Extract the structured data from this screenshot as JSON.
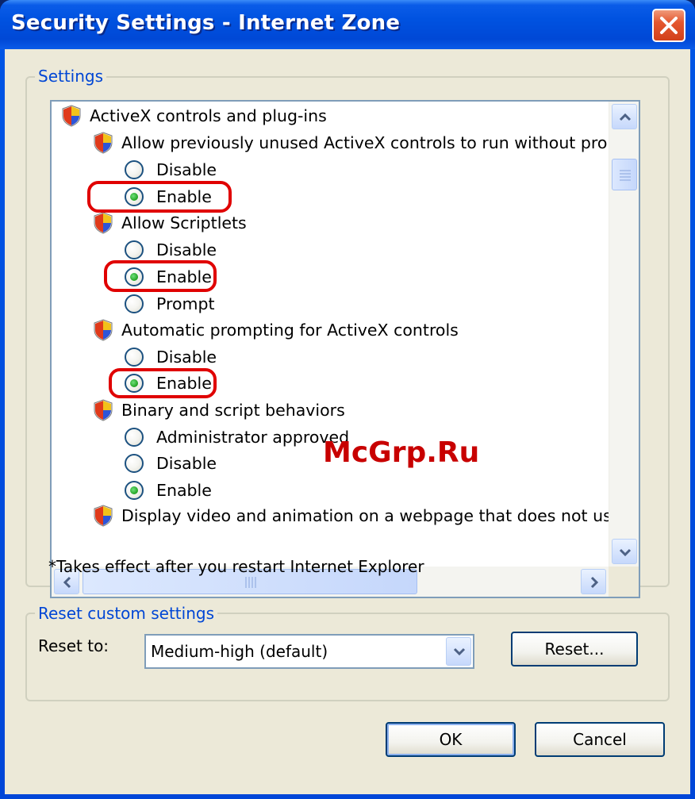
{
  "window": {
    "title": "Security Settings - Internet Zone"
  },
  "settings_group": {
    "label": "Settings",
    "items": [
      {
        "kind": "category",
        "text": "ActiveX controls and plug-ins"
      },
      {
        "kind": "setting",
        "text": "Allow previously unused ActiveX controls to run without prom"
      },
      {
        "kind": "option",
        "text": "Disable",
        "checked": false
      },
      {
        "kind": "option",
        "text": "Enable",
        "checked": true
      },
      {
        "kind": "setting",
        "text": "Allow Scriptlets"
      },
      {
        "kind": "option",
        "text": "Disable",
        "checked": false
      },
      {
        "kind": "option",
        "text": "Enable",
        "checked": true
      },
      {
        "kind": "option",
        "text": "Prompt",
        "checked": false
      },
      {
        "kind": "setting",
        "text": "Automatic prompting for ActiveX controls"
      },
      {
        "kind": "option",
        "text": "Disable",
        "checked": false
      },
      {
        "kind": "option",
        "text": "Enable",
        "checked": true
      },
      {
        "kind": "setting",
        "text": "Binary and script behaviors"
      },
      {
        "kind": "option",
        "text": "Administrator approved",
        "checked": false
      },
      {
        "kind": "option",
        "text": "Disable",
        "checked": false
      },
      {
        "kind": "option",
        "text": "Enable",
        "checked": true
      },
      {
        "kind": "setting",
        "text": "Display video and animation on a webpage that does not use"
      }
    ],
    "note": "*Takes effect after you restart Internet Explorer"
  },
  "reset_group": {
    "label": "Reset custom settings",
    "reset_to_label": "Reset to:",
    "reset_to_value": "Medium-high (default)",
    "reset_button": "Reset..."
  },
  "buttons": {
    "ok": "OK",
    "cancel": "Cancel"
  },
  "watermark": "McGrp.Ru",
  "colors": {
    "title_bar": "#0052e0",
    "dialog_bg": "#ece9d8",
    "group_label": "#0046d5",
    "highlight_ring": "#e00000",
    "radio_checked": "#21a121"
  }
}
